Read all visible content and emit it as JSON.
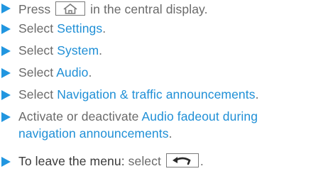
{
  "steps": [
    {
      "pre": "Press ",
      "icon": "home-icon",
      "post": " in the central display."
    },
    {
      "pre": "Select ",
      "link": "Settings",
      "post": "."
    },
    {
      "pre": "Select ",
      "link": "System",
      "post": "."
    },
    {
      "pre": "Select ",
      "link": "Audio",
      "post": "."
    },
    {
      "pre": "Select ",
      "link": "Navigation & traffic announcements",
      "post": "."
    },
    {
      "pre": "Activate or deactivate ",
      "link_line1": "Audio fadeout during",
      "link_line2": "navigation announcements",
      "post": "."
    },
    {
      "strong": "To leave the menu:",
      "pre": " select ",
      "icon": "back-icon",
      "post": "."
    }
  ],
  "colors": {
    "bullet": "#2196e0",
    "link": "#1f8fd6",
    "text": "#6a6a6a"
  }
}
